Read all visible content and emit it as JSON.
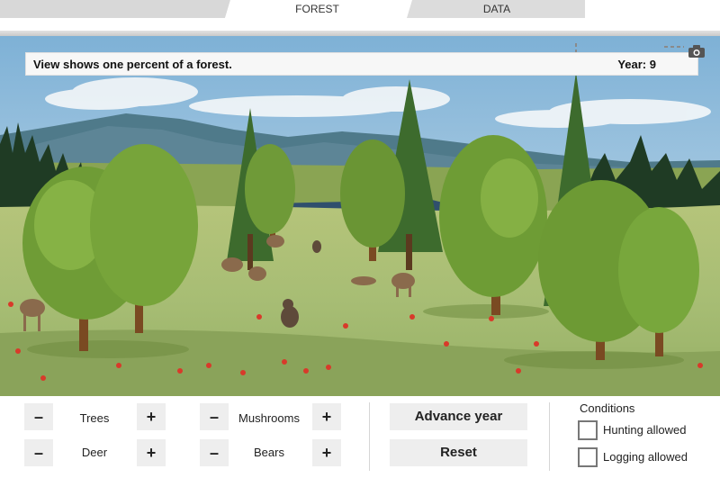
{
  "tabs": [
    {
      "label": "FOREST",
      "active": true
    },
    {
      "label": "DATA",
      "active": false
    }
  ],
  "scene": {
    "info_text": "View shows one percent of a forest.",
    "year_label": "Year:",
    "year_value": "9",
    "camera_icon": "camera-icon"
  },
  "controls": {
    "minus_symbol": "–",
    "plus_symbol": "+",
    "trees_label": "Trees",
    "deer_label": "Deer",
    "mushrooms_label": "Mushrooms",
    "bears_label": "Bears",
    "advance_label": "Advance year",
    "reset_label": "Reset"
  },
  "conditions": {
    "title": "Conditions",
    "hunting_label": "Hunting allowed",
    "hunting_checked": false,
    "logging_label": "Logging allowed",
    "logging_checked": false
  },
  "colors": {
    "sky_top": "#7fb3d8",
    "sky_bottom": "#cfe3ef",
    "meadow": "#a9bd72",
    "tree_foliage": "#6d9a35",
    "conifer": "#3f6a2a",
    "button_bg": "#eeeeee"
  }
}
